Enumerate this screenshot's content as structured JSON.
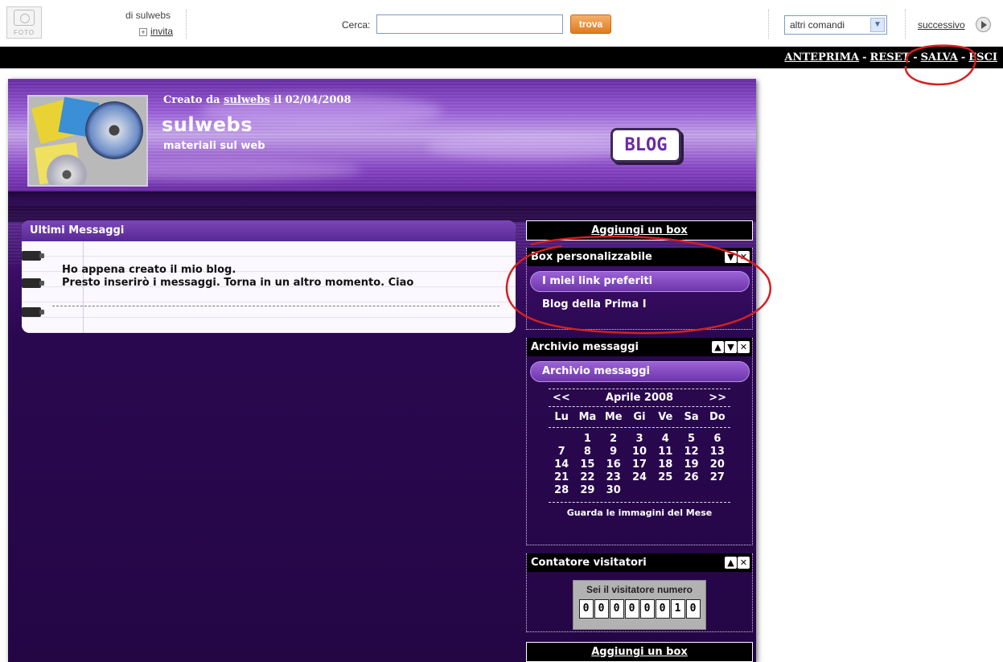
{
  "toolbar": {
    "foto_label": "FOTO",
    "owner_text": "di sulwebs",
    "invite_label": "invita",
    "search_label": "Cerca:",
    "search_value": "",
    "search_button": "trova",
    "commands_selected": "altri comandi",
    "next_label": "successivo"
  },
  "actions": {
    "preview": "ANTEPRIMA",
    "reset": "RESET",
    "save": "SALVA",
    "exit": "ESCI",
    "separator": "-"
  },
  "blog": {
    "created_prefix": "Creato da",
    "created_user": "sulwebs",
    "created_date": "il 02/04/2008",
    "title": "sulwebs",
    "subtitle": "materiali sul web",
    "badge": "BLOG"
  },
  "messages": {
    "header": "Ultimi Messaggi",
    "line1": "Ho appena creato il mio blog.",
    "line2": "Presto inserirò i messaggi. Torna in un altro momento. Ciao"
  },
  "sidebar": {
    "add_box_label": "Aggiungi un box",
    "custom_box": {
      "title": "Box personalizzabile",
      "pill": "I miei link preferiti",
      "link": "Blog della Prima I"
    },
    "archive_box": {
      "title": "Archivio messaggi",
      "pill": "Archivio messaggi"
    },
    "calendar": {
      "prev": "<<",
      "month": "Aprile 2008",
      "next": ">>",
      "days": [
        "Lu",
        "Ma",
        "Me",
        "Gi",
        "Ve",
        "Sa",
        "Do"
      ],
      "weeks": [
        [
          "",
          "1",
          "2",
          "3",
          "4",
          "5",
          "6"
        ],
        [
          "7",
          "8",
          "9",
          "10",
          "11",
          "12",
          "13"
        ],
        [
          "14",
          "15",
          "16",
          "17",
          "18",
          "19",
          "20"
        ],
        [
          "21",
          "22",
          "23",
          "24",
          "25",
          "26",
          "27"
        ],
        [
          "28",
          "29",
          "30",
          "",
          "",
          "",
          ""
        ]
      ],
      "footer": "Guarda le immagini del Mese"
    },
    "counter_box": {
      "title": "Contatore visitatori",
      "label": "Sei il visitatore numero",
      "digits": [
        "0",
        "0",
        "0",
        "0",
        "0",
        "0",
        "1",
        "0"
      ]
    }
  },
  "icons": {
    "up": "▲",
    "down": "▼",
    "close": "✕"
  },
  "colors": {
    "annotation": "#d42020",
    "theme_purple": "#6a2aa6",
    "search_button": "#e07a1e"
  }
}
